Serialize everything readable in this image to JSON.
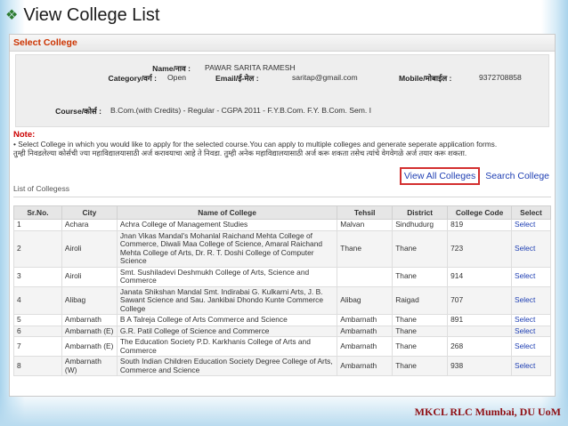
{
  "slide": {
    "title": "View College List",
    "footer": "MKCL RLC Mumbai, DU UoM"
  },
  "panel": {
    "header": "Select College"
  },
  "student": {
    "name_label": "Name/नाव :",
    "name": "PAWAR SARITA RAMESH",
    "category_label": "Category/वर्ग :",
    "category": "Open",
    "email_label": "Email/ई-मेल :",
    "email": "saritap@gmail.com",
    "mobile_label": "Mobile/मोबाईल :",
    "mobile": "9372708858",
    "course_label": "Course/कोर्स :",
    "course": "B.Com.(with Credits) - Regular - CGPA 2011 - F.Y.B.Com. F.Y. B.Com. Sem. I"
  },
  "note": {
    "title": "Note:",
    "text_en": "• Select College in which you would like to apply for the selected course.You can apply to multiple colleges and generate seperate application forms.",
    "text_mr": "तुम्ही निवडलेल्या कोर्सची ज्या महाविद्यालयासाठी अर्ज करावयाचा आहे ते निवडा. तुम्ही अनेक महाविद्यालयासाठी अर्ज करू शकता तसेच त्यांचे वेगवेगळे अर्ज तयार करू शकता."
  },
  "actions": {
    "view_all": "View All Colleges",
    "search": "Search College"
  },
  "list_title": "List of Collegess",
  "table": {
    "headers": [
      "Sr.No.",
      "City",
      "Name of College",
      "Tehsil",
      "District",
      "College Code",
      "Select"
    ],
    "rows": [
      [
        "1",
        "Achara",
        "Achra College of Management Studies",
        "Malvan",
        "Sindhudurg",
        "819",
        "Select"
      ],
      [
        "2",
        "Airoli",
        "Jnan Vikas Mandal's Mohanlal Raichand Mehta College of Commerce, Diwali Maa College of Science, Amaral Raichand Mehta College of Arts, Dr. R. T. Doshi College of Computer Science",
        "Thane",
        "Thane",
        "723",
        "Select"
      ],
      [
        "3",
        "Airoli",
        "Smt. Sushiladevi Deshmukh College of Arts, Science and Commerce",
        "",
        "Thane",
        "914",
        "Select"
      ],
      [
        "4",
        "Alibag",
        "Janata Shikshan Mandal Smt. Indirabai G. Kulkarni Arts, J. B. Sawant Science and Sau. Jankibai Dhondo Kunte Commerce College",
        "Alibag",
        "Raigad",
        "707",
        "Select"
      ],
      [
        "5",
        "Ambarnath",
        "B A Talreja College of Arts Commerce and Science",
        "Ambarnath",
        "Thane",
        "891",
        "Select"
      ],
      [
        "6",
        "Ambarnath (E)",
        "G.R. Patil College of Science and Commerce",
        "Ambarnath",
        "Thane",
        "",
        "Select"
      ],
      [
        "7",
        "Ambarnath (E)",
        "The Education Society P.D. Karkhanis College of Arts and Commerce",
        "Ambarnath",
        "Thane",
        "268",
        "Select"
      ],
      [
        "8",
        "Ambarnath (W)",
        "South Indian Children Education Society Degree College of Arts, Commerce and Science",
        "Ambarnath",
        "Thane",
        "938",
        "Select"
      ]
    ]
  },
  "colors": {
    "accent_red": "#cc3300",
    "link_blue": "#1f3fb3",
    "footer": "#8e0d12",
    "bullet_green": "#2e7d32"
  }
}
